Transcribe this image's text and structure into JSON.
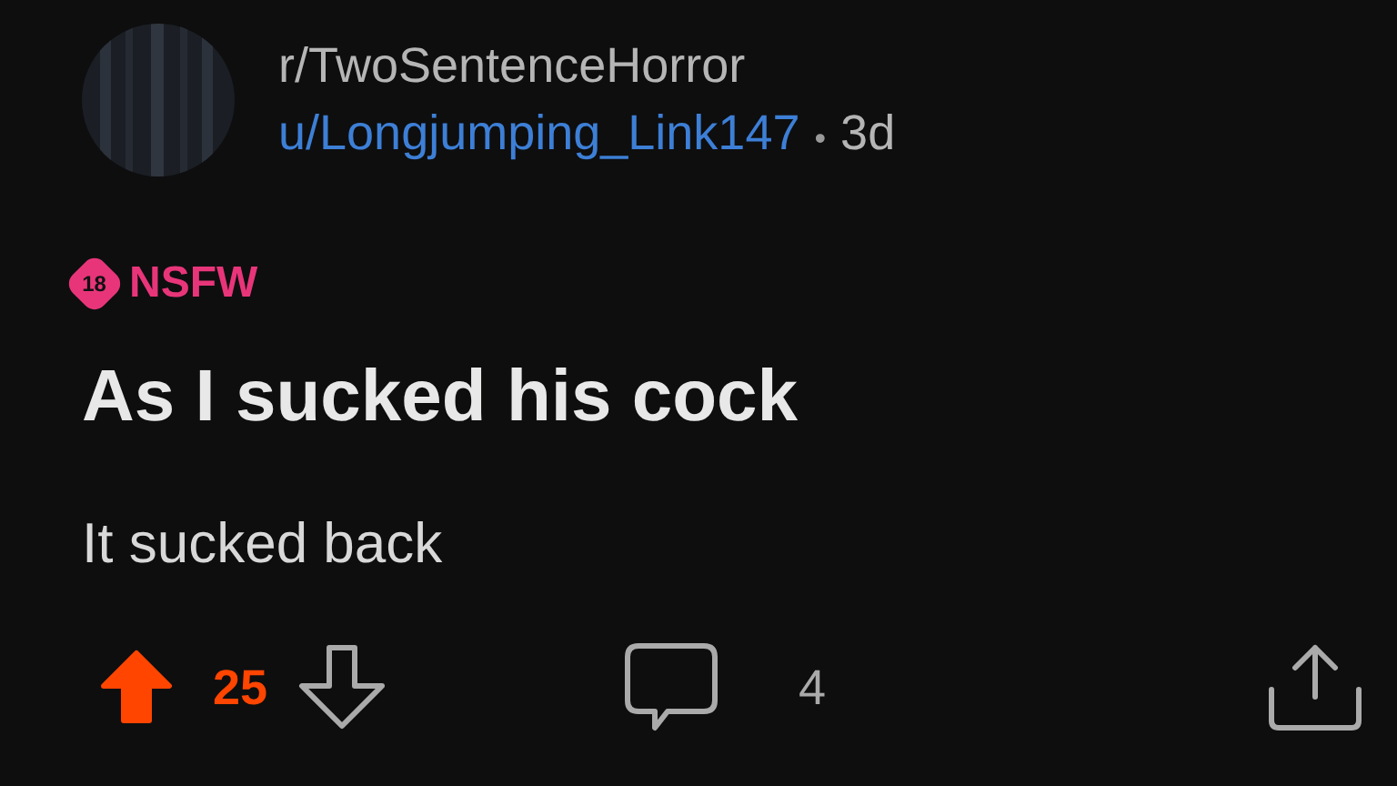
{
  "post": {
    "subreddit": "r/TwoSentenceHorror",
    "author": "u/Longjumping_Link147",
    "separator": "•",
    "age": "3d",
    "nsfw": {
      "badge": "18",
      "label": "NSFW"
    },
    "title": "As I sucked his cock",
    "body": "It sucked back",
    "actions": {
      "upvoted": true,
      "downvoted": false,
      "score": "25",
      "comments": "4"
    }
  }
}
